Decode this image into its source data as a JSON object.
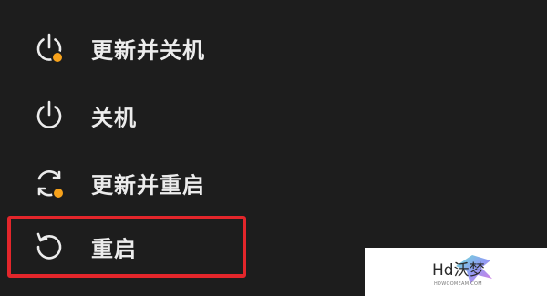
{
  "menu": {
    "items": [
      {
        "label": "更新并关机",
        "icon": "power-update-icon"
      },
      {
        "label": "关机",
        "icon": "power-icon"
      },
      {
        "label": "更新并重启",
        "icon": "restart-update-icon"
      },
      {
        "label": "重启",
        "icon": "restart-icon"
      }
    ]
  },
  "watermark": {
    "brand": "Hd沃梦",
    "url": "HDWOOMEAM.COM"
  },
  "colors": {
    "background": "#1d1d1d",
    "text": "#ececec",
    "update_badge": "#f7a21b",
    "highlight_border": "#e3262b"
  }
}
